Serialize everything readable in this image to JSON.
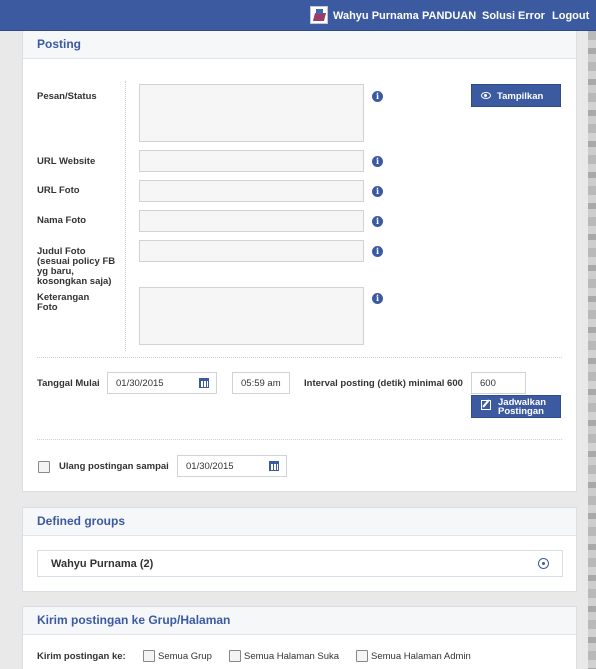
{
  "topbar": {
    "user_name": "Wahyu Purnama",
    "nav": [
      "PANDUAN",
      "Solusi Error",
      "Logout"
    ]
  },
  "posting": {
    "title": "Posting",
    "fields": {
      "message_label": "Pesan/Status",
      "url_website_label": "URL Website",
      "url_photo_label": "URL Foto",
      "photo_name_label": "Nama Foto",
      "photo_title_label": "Judul Foto (sesuai policy FB yg baru, kosongkan saja)",
      "photo_desc_label": "Keterangan Foto"
    },
    "show_button": "Tampilkan",
    "start_date_label": "Tanggal Mulai",
    "start_date_value": "01/30/2015",
    "start_time_value": "05:59 am",
    "interval_label": "Interval posting (detik) minimal 600",
    "interval_value": "600",
    "schedule_button": "Jadwalkan Postingan",
    "repeat_label": "Ulang postingan sampai",
    "repeat_date_value": "01/30/2015"
  },
  "groups": {
    "title": "Defined groups",
    "items": [
      {
        "label": "Wahyu Purnama (2)"
      }
    ]
  },
  "send": {
    "title": "Kirim postingan ke Grup/Halaman",
    "to_label": "Kirim postingan ke:",
    "options": [
      "Semua Grup",
      "Semua Halaman Suka",
      "Semua Halaman Admin"
    ]
  },
  "colors": {
    "accent": "#3b5aa0",
    "topbar": "#3b5aa0",
    "panel_border": "#d9dde4"
  },
  "icons": [
    "info-icon",
    "eye-icon",
    "edit-icon",
    "calendar-icon",
    "expand-circle-icon"
  ]
}
